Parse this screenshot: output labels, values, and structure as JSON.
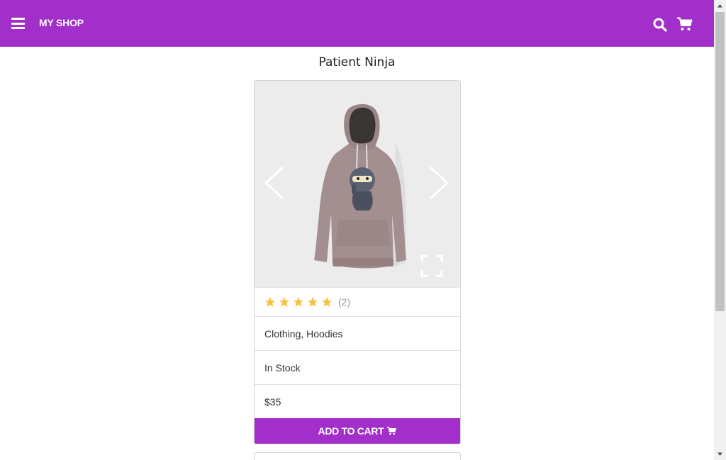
{
  "header": {
    "brand": "MY SHOP",
    "menu_icon": "hamburger-menu-icon",
    "search_icon": "search-icon",
    "cart_icon": "shopping-cart-icon",
    "background_color": "#a22fc9"
  },
  "product": {
    "title": "Patient Ninja",
    "rating": {
      "stars": 5,
      "max": 5,
      "count_label": "(2)"
    },
    "categories": "Clothing, Hoodies",
    "stock_status": "In Stock",
    "price": "$35",
    "add_to_cart_label": "ADD TO CART",
    "star_color": "#f5c242",
    "accent_color": "#a22fc9"
  }
}
